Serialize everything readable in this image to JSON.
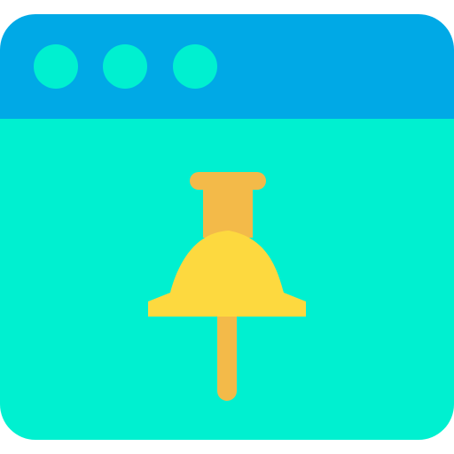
{
  "colors": {
    "titlebar": "#00A9E6",
    "content": "#00F0D0",
    "window_dot": "#00F0D0",
    "pin_stem": "#F3BA49",
    "pin_head": "#FDD93F"
  },
  "window": {
    "controls": [
      {
        "icon": "window-dot-icon"
      },
      {
        "icon": "window-dot-icon"
      },
      {
        "icon": "window-dot-icon"
      }
    ]
  },
  "content": {
    "icon": "pushpin-icon"
  }
}
